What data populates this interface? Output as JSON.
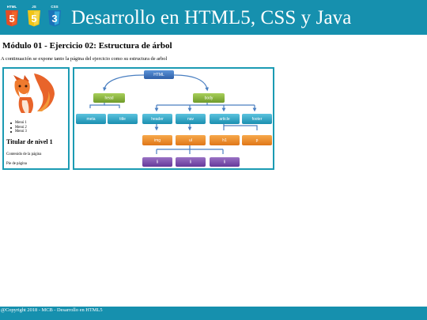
{
  "header": {
    "title": "Desarrollo en HTML5, CSS y Java",
    "badges": [
      {
        "icon": "html5-badge-icon",
        "label": "HTML",
        "number": "5",
        "color": "#e44d26"
      },
      {
        "icon": "js-badge-icon",
        "label": "JS",
        "number": "5",
        "color": "#f0c419"
      },
      {
        "icon": "css3-badge-icon",
        "label": "CSS",
        "number": "3",
        "color": "#1b73ba"
      }
    ]
  },
  "main": {
    "module_title": "Módulo 01 - Ejercicio 02: Estructura de árbol",
    "intro": "A continuación se expone tanto la página del ejercicio como su estructura de arbol"
  },
  "left_panel": {
    "logo_icon": "firefox-fox-icon",
    "menu": [
      "Menú 1",
      "Menú 2",
      "Menú 3"
    ],
    "heading": "Titular de nivel 1",
    "content": "Contenido de la página",
    "footer": "Pie de página"
  },
  "tree": {
    "colors": {
      "blue": "#2e6fc2",
      "green": "#86b53a",
      "teal": "#2aa8c8",
      "orange": "#ef8a23",
      "purple": "#7b4fa8",
      "line": "#4a7fc1"
    },
    "nodes": {
      "html": "HTML",
      "head": "head",
      "body": "body",
      "meta": "meta",
      "title": "title",
      "header": "header",
      "nav": "nav",
      "article": "article",
      "footer": "footer",
      "img": "img",
      "ul": "ul",
      "h1": "h1",
      "p": "p",
      "li1": "li",
      "li2": "li",
      "li3": "li"
    }
  },
  "footer": {
    "copyright": "@Copyright 2018 - MCB - Desarrollo en HTML5"
  }
}
